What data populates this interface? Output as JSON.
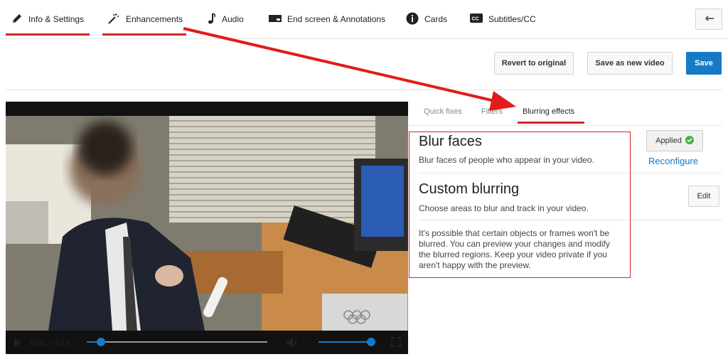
{
  "tabs": [
    {
      "label": "Info & Settings",
      "icon": "pencil-icon"
    },
    {
      "label": "Enhancements",
      "icon": "magic-wand-icon"
    },
    {
      "label": "Audio",
      "icon": "music-note-icon"
    },
    {
      "label": "End screen & Annotations",
      "icon": "end-screen-icon"
    },
    {
      "label": "Cards",
      "icon": "info-icon"
    },
    {
      "label": "Subtitles/CC",
      "icon": "cc-icon"
    }
  ],
  "actions": {
    "revert": "Revert to original",
    "save_new": "Save as new video",
    "save": "Save"
  },
  "subtabs": [
    "Quick fixes",
    "Filters",
    "Blurring effects"
  ],
  "blur_faces": {
    "title": "Blur faces",
    "description": "Blur faces of people who appear in your video.",
    "status": "Applied",
    "link": "Reconfigure"
  },
  "custom_blurring": {
    "title": "Custom blurring",
    "description": "Choose areas to blur and track in your video.",
    "button": "Edit",
    "note_lines": [
      "It's possible that certain objects or frames won't be",
      "blurred. You can preview your changes and modify",
      "the blurred regions. Keep your video private if you",
      "aren't happy with the preview."
    ]
  },
  "player": {
    "time": "0:01 / 0:16",
    "progress": 0.08,
    "volume": 1.0
  },
  "colors": {
    "accent": "#d0272d",
    "link": "#167ac6",
    "save": "#167ac6"
  }
}
